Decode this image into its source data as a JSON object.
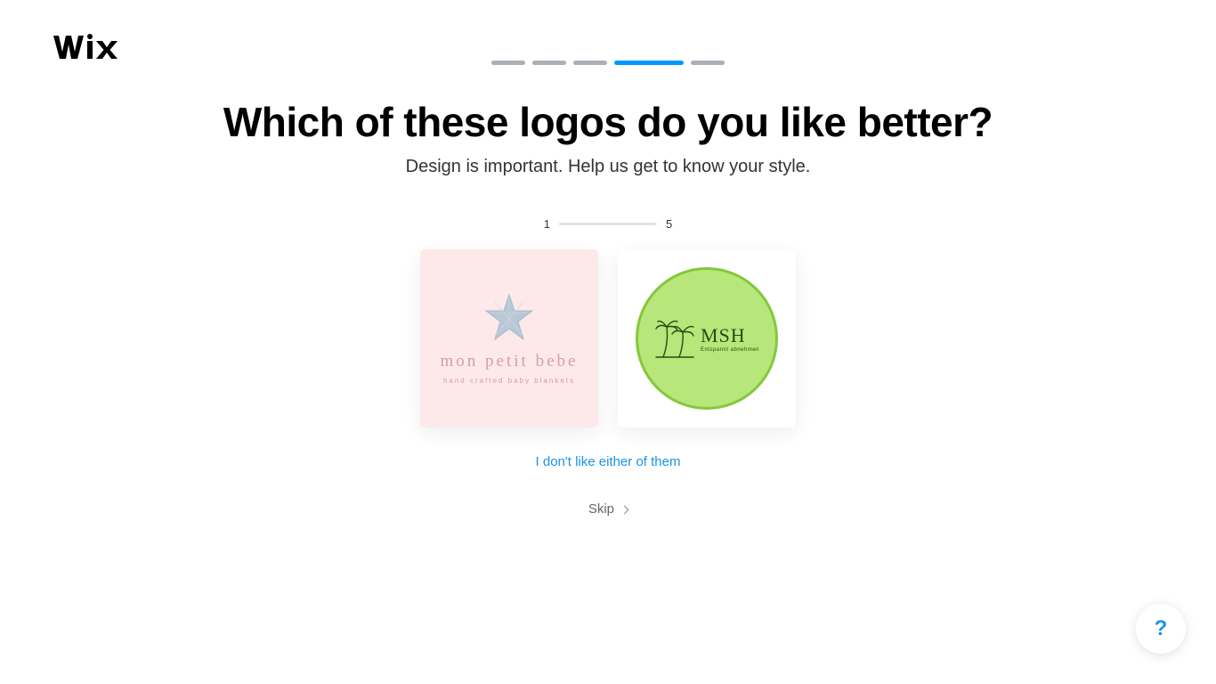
{
  "brand_logo_text": "WiX",
  "stepper": {
    "total": 5,
    "active_index": 3
  },
  "title": "Which of these logos do you like better?",
  "subtitle": "Design is important. Help us get to know your style.",
  "progress": {
    "current": "1",
    "total": "5"
  },
  "card_a": {
    "icon_name": "star-icon",
    "brand": "mon petit bebe",
    "tagline": "hand crafted baby blankets"
  },
  "card_b": {
    "icon_name": "palm-tree-icon",
    "brand": "MSH",
    "tagline": "Entspannt abnehmen"
  },
  "dislike_link": "I don't like either of them",
  "skip_label": "Skip",
  "help_label": "?"
}
